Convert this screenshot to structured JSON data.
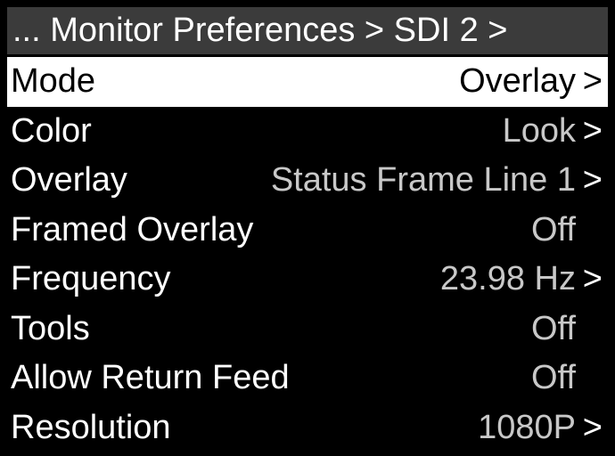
{
  "header": {
    "title": "... Monitor Preferences > SDI 2 >"
  },
  "menu": {
    "items": [
      {
        "label": "Mode",
        "value": "Overlay",
        "chevron": ">"
      },
      {
        "label": "Color",
        "value": "Look",
        "chevron": ">"
      },
      {
        "label": "Overlay",
        "value": "Status Frame Line 1",
        "chevron": ">"
      },
      {
        "label": "Framed Overlay",
        "value": "Off",
        "chevron": ""
      },
      {
        "label": "Frequency",
        "value": "23.98 Hz",
        "chevron": ">"
      },
      {
        "label": "Tools",
        "value": "Off",
        "chevron": ""
      },
      {
        "label": "Allow Return Feed",
        "value": "Off",
        "chevron": ""
      },
      {
        "label": "Resolution",
        "value": "1080P",
        "chevron": ">"
      }
    ]
  },
  "colors": {
    "background": "#000000",
    "header_bg": "#3b3b3b",
    "selected_bg": "#ffffff",
    "value_text": "#c8c8c8"
  }
}
